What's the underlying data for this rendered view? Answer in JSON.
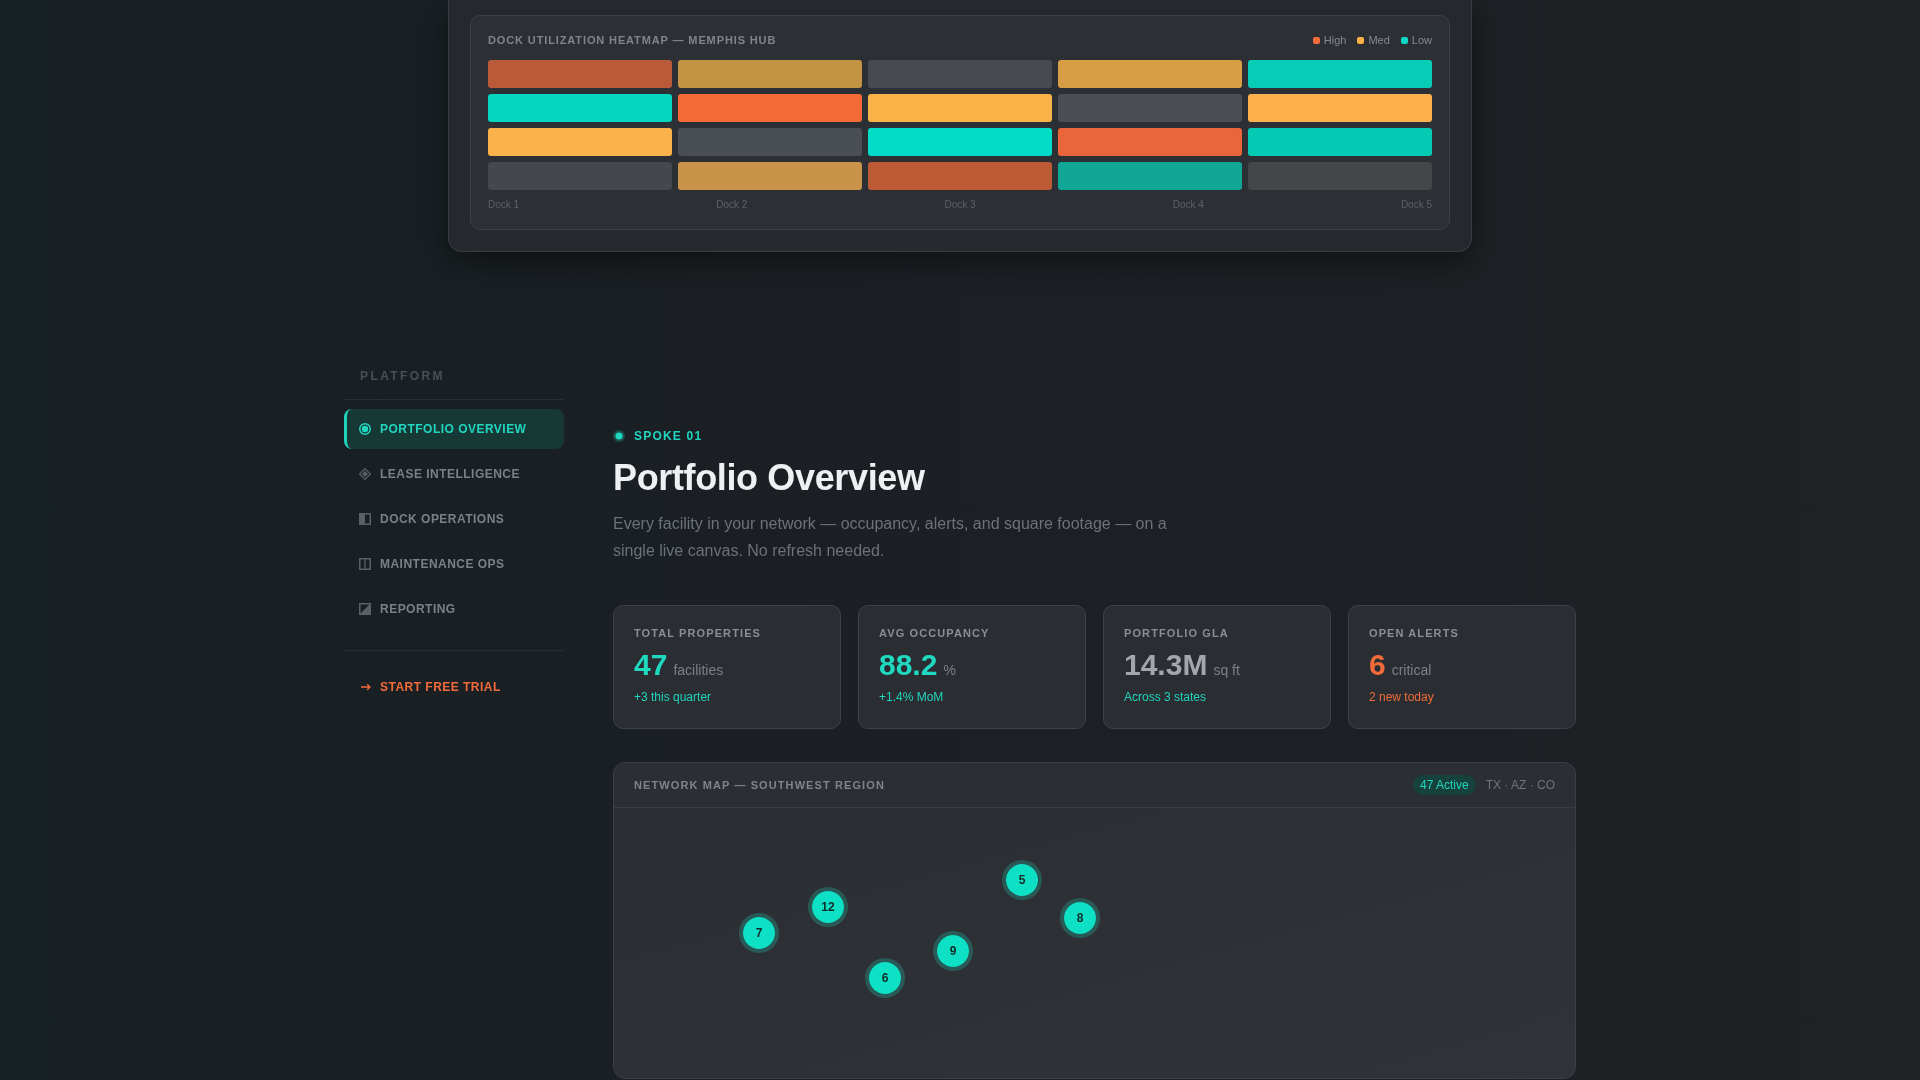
{
  "dock_heatmap": {
    "title": "DOCK UTILIZATION HEATMAP — MEMPHIS HUB",
    "legend": [
      {
        "label": "High",
        "color": "#f46b3a"
      },
      {
        "label": "Med",
        "color": "#fbb14a"
      },
      {
        "label": "Low",
        "color": "#0ad8c4"
      }
    ],
    "rows": [
      {
        "cells": [
          {
            "color": "#b95b38"
          },
          {
            "color": "#c29343"
          },
          {
            "color": "#474b51"
          },
          {
            "color": "#d89e45"
          },
          {
            "color": "#07cdb7"
          }
        ]
      },
      {
        "cells": [
          {
            "color": "#05d6c1"
          },
          {
            "color": "#f56a37"
          },
          {
            "color": "#f9b148"
          },
          {
            "color": "#4b4e52"
          },
          {
            "color": "#fcb04a"
          }
        ]
      },
      {
        "cells": [
          {
            "color": "#fbb149"
          },
          {
            "color": "#4a4f53"
          },
          {
            "color": "#03dcc7"
          },
          {
            "color": "#ea6539"
          },
          {
            "color": "#05cbb5"
          }
        ]
      },
      {
        "cells": [
          {
            "color": "#44484e"
          },
          {
            "color": "#c7944a"
          },
          {
            "color": "#bd5b37"
          },
          {
            "color": "#11a797"
          },
          {
            "color": "#444649"
          }
        ]
      }
    ],
    "columns": [
      "Dock 1",
      "Dock 2",
      "Dock 3",
      "Dock 4",
      "Dock 5"
    ]
  },
  "sidebar": {
    "heading": "PLATFORM",
    "items": [
      {
        "label": "PORTFOLIO OVERVIEW",
        "selected": true
      },
      {
        "label": "LEASE INTELLIGENCE",
        "selected": false
      },
      {
        "label": "DOCK OPERATIONS",
        "selected": false
      },
      {
        "label": "MAINTENANCE OPS",
        "selected": false
      },
      {
        "label": "REPORTING",
        "selected": false
      }
    ],
    "cta": "START FREE TRIAL"
  },
  "page": {
    "eyebrow": "SPOKE 01",
    "title": "Portfolio Overview",
    "description": "Every facility in your network — occupancy, alerts, and square footage — on a single live canvas. No refresh needed."
  },
  "stats": [
    {
      "label": "TOTAL PROPERTIES",
      "value": "47",
      "unit": "facilities",
      "change": "+3 this quarter",
      "kind": "accent"
    },
    {
      "label": "AVG OCCUPANCY",
      "value": "88.2",
      "unit": "%",
      "change": "+1.4% MoM",
      "kind": "accent"
    },
    {
      "label": "PORTFOLIO GLA",
      "value": "14.3M",
      "unit": "sq ft",
      "change": "Across 3 states",
      "kind": "neutral"
    },
    {
      "label": "OPEN ALERTS",
      "value": "6",
      "unit": "critical",
      "change": "2 new today",
      "kind": "alert"
    }
  ],
  "network_map": {
    "title": "NETWORK MAP — SOUTHWEST REGION",
    "badge": "47 Active",
    "regions": "TX · AZ · CO",
    "markers": [
      {
        "label": "7"
      },
      {
        "label": "12"
      },
      {
        "label": "6"
      },
      {
        "label": "9"
      },
      {
        "label": "5"
      },
      {
        "label": "8"
      }
    ]
  }
}
